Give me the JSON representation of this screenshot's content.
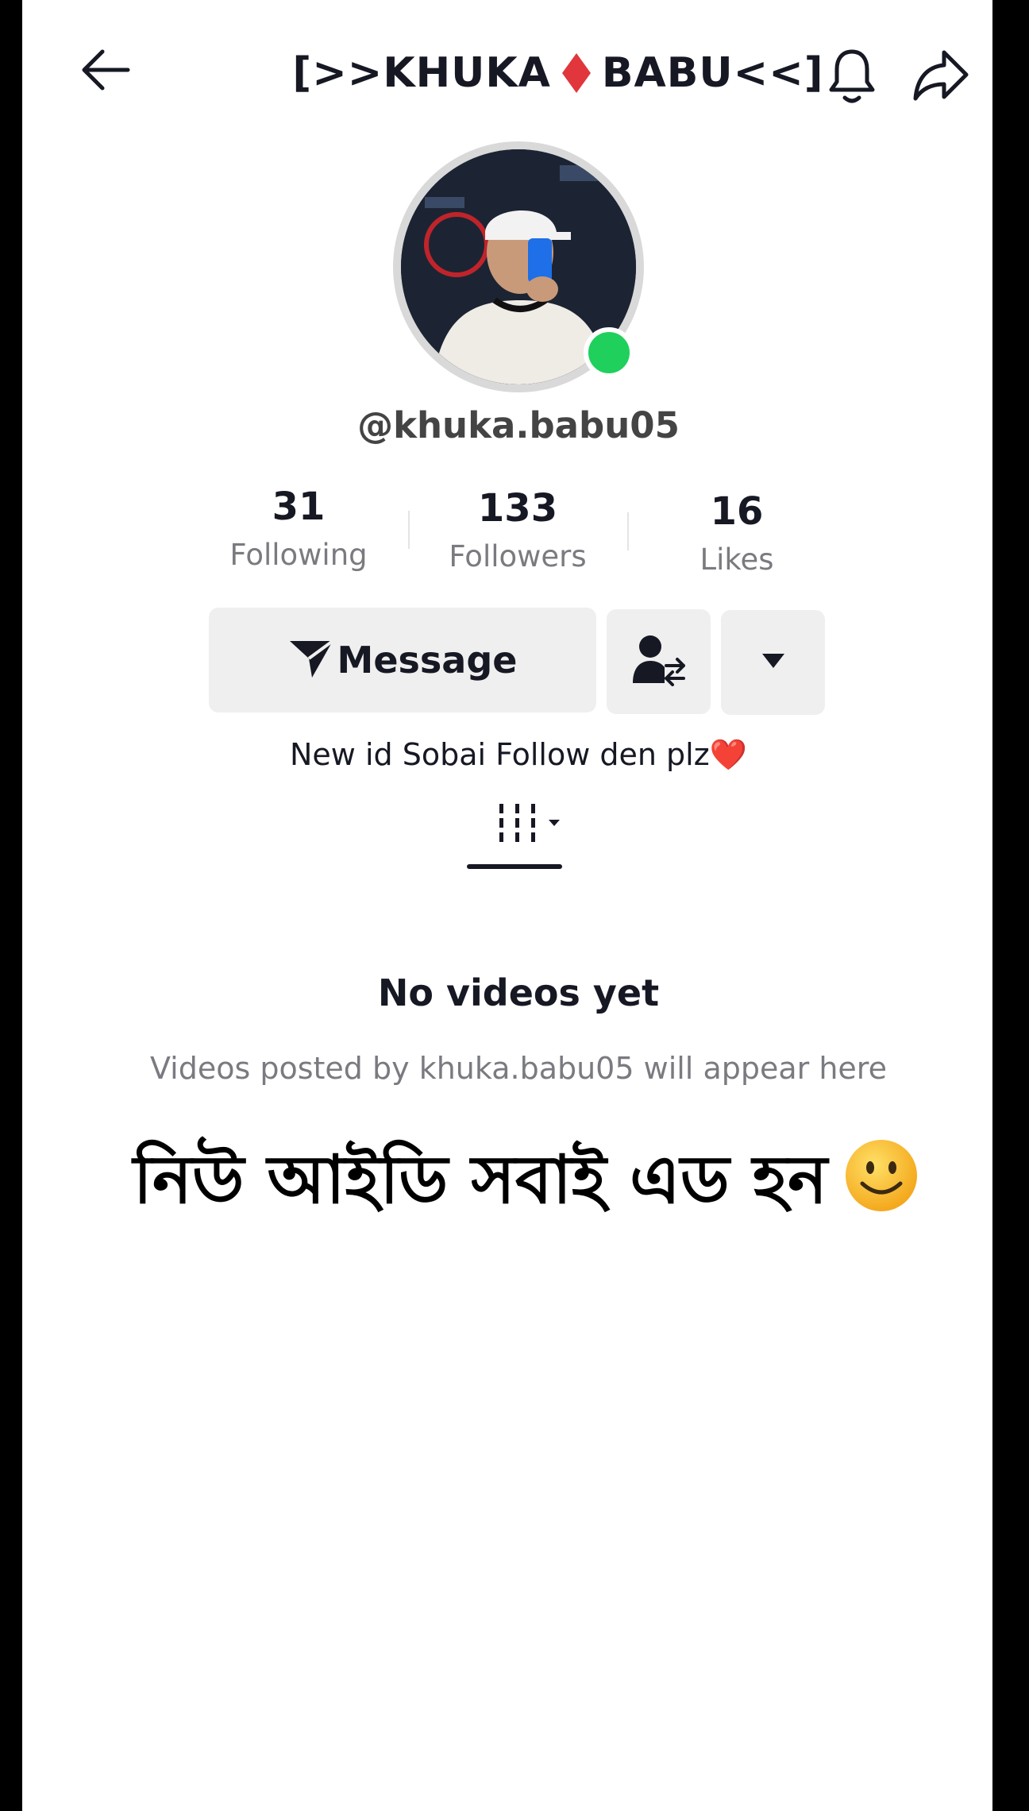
{
  "header": {
    "title_left": "[>>KHUKA",
    "title_right": "BABU<<]",
    "title_icon": "red-diamond-icon",
    "back_icon": "arrow-left-icon",
    "notification_icon": "bell-icon",
    "share_icon": "share-icon"
  },
  "profile": {
    "username": "@khuka.babu05",
    "online": true,
    "avatar_icon": "profile-photo",
    "stats": [
      {
        "value": "31",
        "label": "Following"
      },
      {
        "value": "133",
        "label": "Followers"
      },
      {
        "value": "16",
        "label": "Likes"
      }
    ],
    "bio": "New id Sobai Follow den plz❤️"
  },
  "actions": {
    "message_label": "Message",
    "message_icon": "send-icon",
    "follow_icon": "user-swap-icon",
    "more_icon": "caret-down-icon"
  },
  "tabs": {
    "videos_icon": "grid-icon"
  },
  "empty_state": {
    "title": "No videos yet",
    "subtitle": "Videos posted by khuka.babu05 will appear here"
  },
  "overlay": {
    "text": "নিউ আইডি সবাই এড হন",
    "emoji": "🙂"
  },
  "colors": {
    "online": "#20d05c",
    "diamond": "#e0363c",
    "button_bg": "#efefef",
    "text_primary": "#161823",
    "text_secondary": "#7a7b80"
  }
}
